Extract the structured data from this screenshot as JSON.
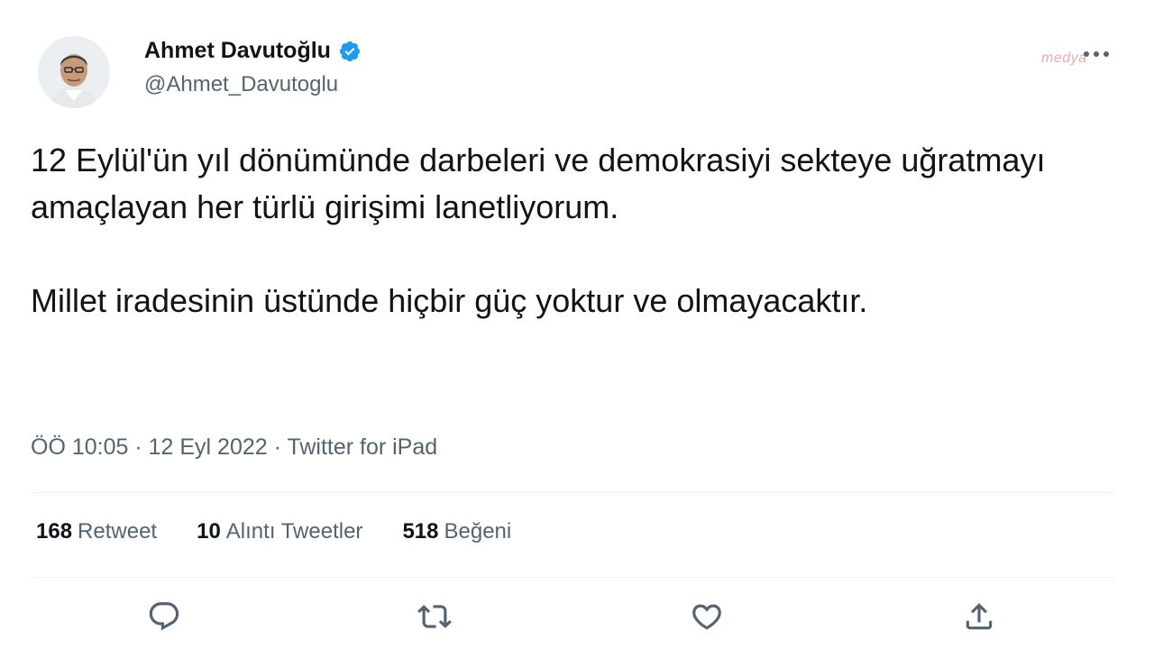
{
  "author": {
    "name": "Ahmet Davutoğlu",
    "handle": "@Ahmet_Davutoglu",
    "verified": true,
    "verified_color": "#1d9bf0"
  },
  "watermark": "medya",
  "tweet": {
    "paragraph1": "12 Eylül'ün yıl dönümünde darbeleri ve demokrasiyi sekteye uğratmayı amaçlayan her türlü girişimi lanetliyorum.",
    "paragraph2": "Millet iradesinin üstünde hiçbir güç yoktur ve olmayacaktır."
  },
  "meta": {
    "time": "ÖÖ 10:05",
    "separator": " · ",
    "date": "12 Eyl 2022",
    "source": "Twitter for iPad"
  },
  "stats": {
    "retweets_count": "168",
    "retweets_label": "Retweet",
    "quotes_count": "10",
    "quotes_label": "Alıntı Tweetler",
    "likes_count": "518",
    "likes_label": "Beğeni"
  },
  "actions": {
    "reply_icon": "reply-icon",
    "retweet_icon": "retweet-icon",
    "like_icon": "heart-icon",
    "share_icon": "share-icon"
  },
  "colors": {
    "text": "#0f1419",
    "secondary": "#536471",
    "divider": "#eff3f4"
  }
}
